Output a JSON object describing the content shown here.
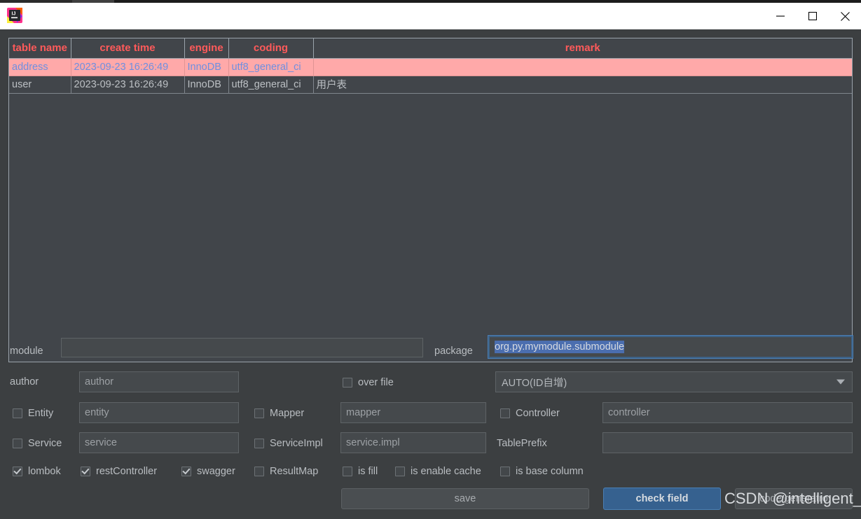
{
  "window": {
    "app_icon": "intellij-idea-icon",
    "controls": [
      {
        "name": "minimize",
        "glyph": "minimize-icon"
      },
      {
        "name": "maximize",
        "glyph": "maximize-icon"
      },
      {
        "name": "close",
        "glyph": "close-icon"
      }
    ]
  },
  "table": {
    "headers": [
      "table name",
      "create time",
      "engine",
      "coding",
      "remark"
    ],
    "rows": [
      {
        "selected": true,
        "cells": [
          "address",
          "2023-09-23 16:26:49",
          "InnoDB",
          "utf8_general_ci",
          ""
        ]
      },
      {
        "selected": false,
        "cells": [
          "user",
          "2023-09-23 16:26:49",
          "InnoDB",
          "utf8_general_ci",
          "用户表"
        ]
      }
    ]
  },
  "form": {
    "module_label": "module",
    "module_value": "",
    "package_label": "package",
    "package_value": "org.py.mymodule.submodule",
    "author_label": "author",
    "author_value": "author",
    "over_file_label": "over file",
    "over_file_checked": false,
    "id_type_value": "AUTO(ID自增)",
    "entity_label": "Entity",
    "entity_checked": false,
    "entity_value": "entity",
    "mapper_label": "Mapper",
    "mapper_checked": false,
    "mapper_value": "mapper",
    "controller_label": "Controller",
    "controller_checked": false,
    "controller_value": "controller",
    "service_label": "Service",
    "service_checked": false,
    "service_value": "service",
    "serviceimpl_label": "ServiceImpl",
    "serviceimpl_checked": false,
    "serviceimpl_value": "service.impl",
    "tableprefix_label": "TablePrefix",
    "tableprefix_value": "",
    "lombok_label": "lombok",
    "lombok_checked": true,
    "rest_controller_label": "restController",
    "rest_controller_checked": true,
    "swagger_label": "swagger",
    "swagger_checked": true,
    "result_map_label": "ResultMap",
    "result_map_checked": false,
    "is_fill_label": "is fill",
    "is_fill_checked": false,
    "is_enable_cache_label": "is enable cache",
    "is_enable_cache_checked": false,
    "is_base_column_label": "is base column",
    "is_base_column_checked": false
  },
  "buttons": {
    "save": "save",
    "check_field": "check field",
    "code_generator": "code generatro"
  },
  "watermark": "CSDN @intelligent_M",
  "colors": {
    "background": "#3c3f41",
    "header_text": "#ff5a5a",
    "selected_row_bg": "#ffa9a9",
    "selected_row_text": "#6e8fe0",
    "primary_button": "#36618f",
    "selection_highlight": "#4b6eaf",
    "field_text": "#9da1a5"
  }
}
